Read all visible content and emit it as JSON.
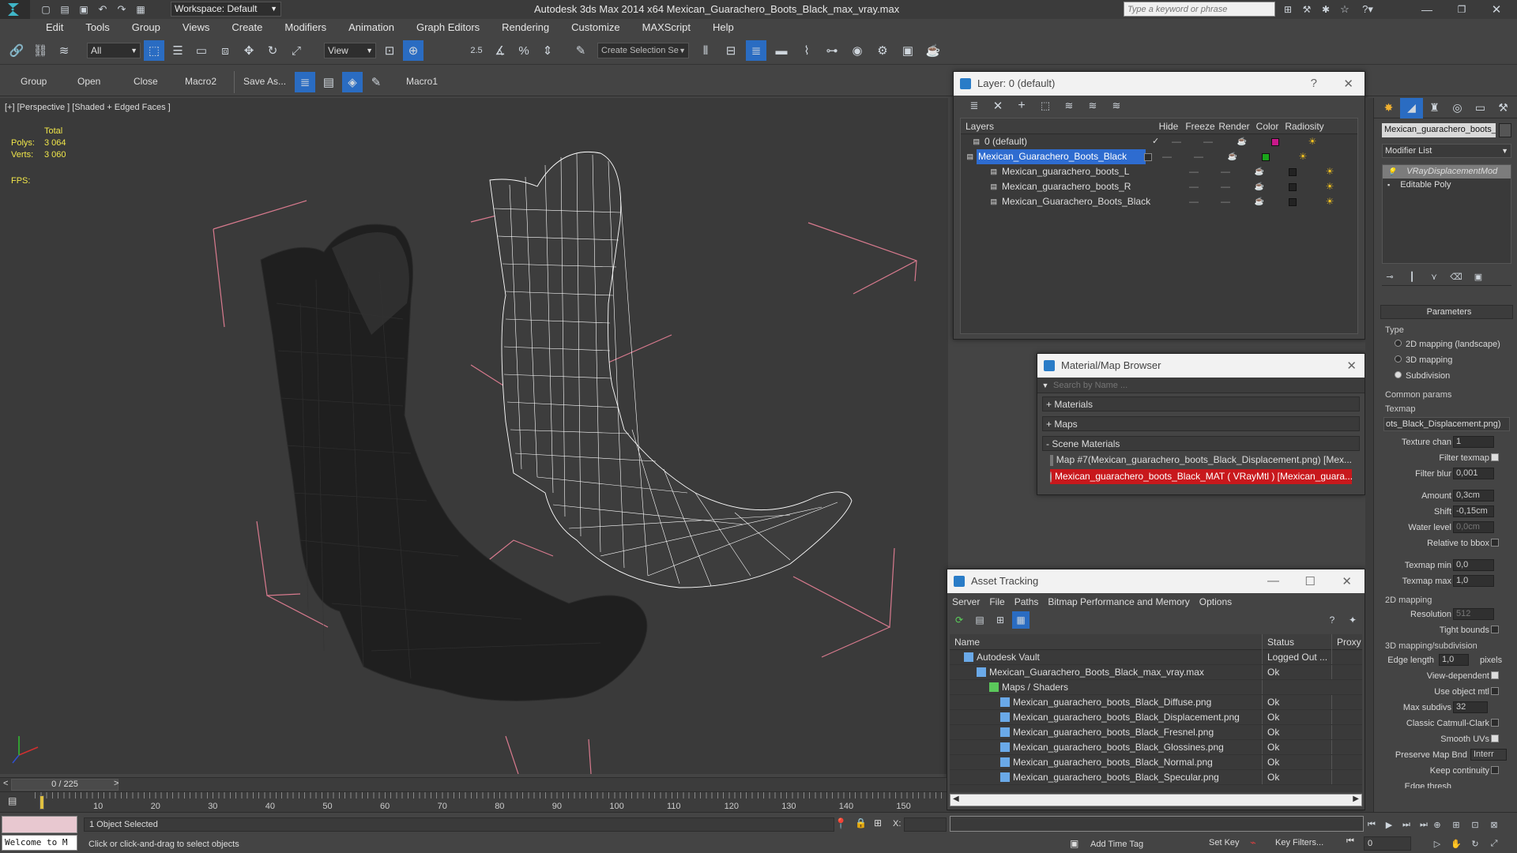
{
  "app": {
    "title": "Autodesk 3ds Max  2014 x64      Mexican_Guarachero_Boots_Black_max_vray.max",
    "workspace": "Workspace: Default",
    "search_placeholder": "Type a keyword or phrase"
  },
  "menu": [
    "Edit",
    "Tools",
    "Group",
    "Views",
    "Create",
    "Modifiers",
    "Animation",
    "Graph Editors",
    "Rendering",
    "Customize",
    "MAXScript",
    "Help"
  ],
  "main_toolbar": {
    "selection_filter": "All",
    "ref_coord": "View",
    "snap_label": "2.5",
    "named_selection": "Create Selection Se"
  },
  "sub_toolbar": [
    "Group",
    "Open",
    "Close",
    "Macro2",
    "Save As...",
    "Macro1"
  ],
  "viewport": {
    "label": "[+] [Perspective ] [Shaded + Edged Faces ]",
    "stats_total": "Total",
    "polys_label": "Polys:",
    "polys_value": "3 064",
    "verts_label": "Verts:",
    "verts_value": "3 060",
    "fps_label": "FPS:"
  },
  "layer_window": {
    "title": "Layer: 0 (default)",
    "help": "?",
    "columns": [
      "Layers",
      "Hide",
      "Freeze",
      "Render",
      "Color",
      "Radiosity"
    ],
    "rows": [
      {
        "name": "0 (default)",
        "color": "#c8188a",
        "check": "✓"
      },
      {
        "name": "Mexican_Guarachero_Boots_Black",
        "color": "#1aa51a",
        "selected": true
      },
      {
        "name": "Mexican_guarachero_boots_L",
        "color": "#222222"
      },
      {
        "name": "Mexican_guarachero_boots_R",
        "color": "#222222"
      },
      {
        "name": "Mexican_Guarachero_Boots_Black",
        "color": "#222222"
      }
    ]
  },
  "material_browser": {
    "title": "Material/Map Browser",
    "search_placeholder": "Search by Name ...",
    "groups": [
      "+ Materials",
      "+ Maps",
      "- Scene Materials"
    ],
    "items": [
      "Map #7(Mexican_guarachero_boots_Black_Displacement.png) [Mex...",
      "Mexican_guarachero_boots_Black_MAT  ( VRayMtl )  [Mexican_guara..."
    ]
  },
  "asset_tracking": {
    "title": "Asset Tracking",
    "menu": [
      "Server",
      "File",
      "Paths",
      "Bitmap Performance and Memory",
      "Options"
    ],
    "columns": [
      "Name",
      "Status",
      "Proxy"
    ],
    "rows": [
      {
        "name": "Autodesk Vault",
        "status": "Logged Out ..."
      },
      {
        "name": "Mexican_Guarachero_Boots_Black_max_vray.max",
        "status": "Ok"
      },
      {
        "name": "Maps / Shaders",
        "status": ""
      },
      {
        "name": "Mexican_guarachero_boots_Black_Diffuse.png",
        "status": "Ok"
      },
      {
        "name": "Mexican_guarachero_boots_Black_Displacement.png",
        "status": "Ok"
      },
      {
        "name": "Mexican_guarachero_boots_Black_Fresnel.png",
        "status": "Ok"
      },
      {
        "name": "Mexican_guarachero_boots_Black_Glossines.png",
        "status": "Ok"
      },
      {
        "name": "Mexican_guarachero_boots_Black_Normal.png",
        "status": "Ok"
      },
      {
        "name": "Mexican_guarachero_boots_Black_Specular.png",
        "status": "Ok"
      }
    ]
  },
  "command_panel": {
    "object_name": "Mexican_guarachero_boots_l",
    "modifier_list": "Modifier List",
    "stack": [
      "VRayDisplacementMod",
      "Editable Poly"
    ],
    "parameters_title": "Parameters",
    "type_label": "Type",
    "type_options": [
      "2D mapping (landscape)",
      "3D mapping",
      "Subdivision"
    ],
    "common_params": "Common params",
    "texmap_label": "Texmap",
    "texmap_value": "ots_Black_Displacement.png)",
    "params": [
      {
        "label": "Texture chan",
        "value": "1"
      },
      {
        "label": "Filter texmap",
        "check": true
      },
      {
        "label": "Filter blur",
        "value": "0,001"
      },
      {
        "label": "Amount",
        "value": "0,3cm"
      },
      {
        "label": "Shift",
        "value": "-0,15cm"
      },
      {
        "label": "Water level",
        "value": "0,0cm"
      },
      {
        "label": "Relative to bbox",
        "check": false
      },
      {
        "label": "Texmap min",
        "value": "0,0"
      },
      {
        "label": "Texmap max",
        "value": "1,0"
      }
    ],
    "mapping2d": "2D mapping",
    "resolution_label": "Resolution",
    "resolution_value": "512",
    "tight_bounds": "Tight bounds",
    "mapping3d": "3D mapping/subdivision",
    "edge_length_label": "Edge length",
    "edge_length_value": "1,0",
    "pixels": "pixels",
    "view_dependent": "View-dependent",
    "use_object_mtl": "Use object mtl",
    "max_subdivs_label": "Max subdivs",
    "max_subdivs_value": "32",
    "classic_catmull": "Classic Catmull-Clark",
    "smooth_uvs": "Smooth UVs",
    "preserve_map": "Preserve Map Bnd",
    "preserve_value": "Interr",
    "keep_continuity": "Keep continuity",
    "edge_thresh": "Edge thresh"
  },
  "timeline": {
    "frame": "0 / 225",
    "ticks": [
      "10",
      "20",
      "30",
      "40",
      "50",
      "60",
      "70",
      "80",
      "90",
      "100",
      "110",
      "120",
      "130",
      "140",
      "150"
    ]
  },
  "status": {
    "maxscript": "Welcome to M",
    "selected": "1 Object Selected",
    "prompt": "Click or click-and-drag to select objects",
    "add_time_tag": "Add Time Tag",
    "set_key": "Set Key",
    "key_filters": "Key Filters...",
    "frame_value": "0",
    "x_label": "X:"
  }
}
